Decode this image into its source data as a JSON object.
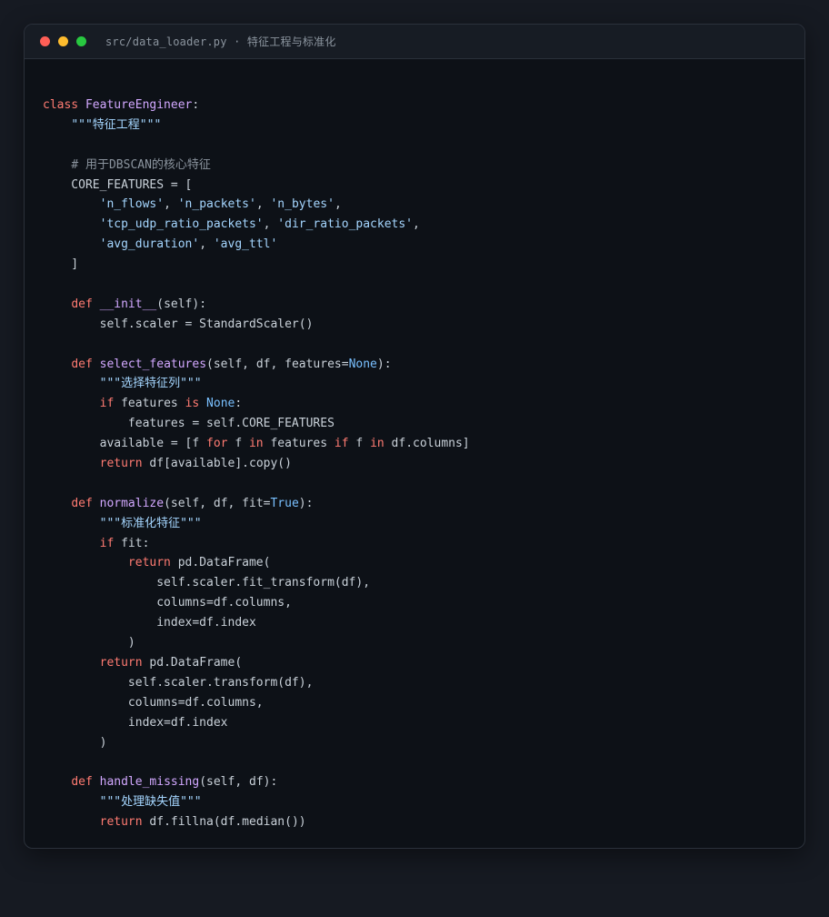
{
  "window": {
    "title": "src/data_loader.py · 特征工程与标准化",
    "controls": {
      "close_color": "#ff5f57",
      "minimize_color": "#febc2e",
      "maximize_color": "#28c840"
    }
  },
  "theme": {
    "background": "#0d1117",
    "keyword": "#ff7b72",
    "function": "#d2a8ff",
    "string": "#a5d6ff",
    "comment": "#8b949e",
    "constant": "#79c0ff",
    "text": "#c9d1d9"
  },
  "code_lines": [
    [
      {
        "t": "kw",
        "v": "class "
      },
      {
        "t": "cls",
        "v": "FeatureEngineer"
      },
      {
        "t": "txt",
        "v": ":"
      }
    ],
    [
      {
        "t": "txt",
        "v": "    "
      },
      {
        "t": "str",
        "v": "\"\"\"特征工程\"\"\""
      }
    ],
    [],
    [
      {
        "t": "txt",
        "v": "    "
      },
      {
        "t": "cmt",
        "v": "# 用于DBSCAN的核心特征"
      }
    ],
    [
      {
        "t": "txt",
        "v": "    CORE_FEATURES = ["
      }
    ],
    [
      {
        "t": "txt",
        "v": "        "
      },
      {
        "t": "str",
        "v": "'n_flows'"
      },
      {
        "t": "txt",
        "v": ", "
      },
      {
        "t": "str",
        "v": "'n_packets'"
      },
      {
        "t": "txt",
        "v": ", "
      },
      {
        "t": "str",
        "v": "'n_bytes'"
      },
      {
        "t": "txt",
        "v": ","
      }
    ],
    [
      {
        "t": "txt",
        "v": "        "
      },
      {
        "t": "str",
        "v": "'tcp_udp_ratio_packets'"
      },
      {
        "t": "txt",
        "v": ", "
      },
      {
        "t": "str",
        "v": "'dir_ratio_packets'"
      },
      {
        "t": "txt",
        "v": ","
      }
    ],
    [
      {
        "t": "txt",
        "v": "        "
      },
      {
        "t": "str",
        "v": "'avg_duration'"
      },
      {
        "t": "txt",
        "v": ", "
      },
      {
        "t": "str",
        "v": "'avg_ttl'"
      }
    ],
    [
      {
        "t": "txt",
        "v": "    ]"
      }
    ],
    [],
    [
      {
        "t": "txt",
        "v": "    "
      },
      {
        "t": "kw",
        "v": "def "
      },
      {
        "t": "fn",
        "v": "__init__"
      },
      {
        "t": "txt",
        "v": "(self):"
      }
    ],
    [
      {
        "t": "txt",
        "v": "        self.scaler = StandardScaler()"
      }
    ],
    [],
    [
      {
        "t": "txt",
        "v": "    "
      },
      {
        "t": "kw",
        "v": "def "
      },
      {
        "t": "fn",
        "v": "select_features"
      },
      {
        "t": "txt",
        "v": "(self, df, features="
      },
      {
        "t": "const",
        "v": "None"
      },
      {
        "t": "txt",
        "v": "):"
      }
    ],
    [
      {
        "t": "txt",
        "v": "        "
      },
      {
        "t": "str",
        "v": "\"\"\"选择特征列\"\"\""
      }
    ],
    [
      {
        "t": "txt",
        "v": "        "
      },
      {
        "t": "kw",
        "v": "if"
      },
      {
        "t": "txt",
        "v": " features "
      },
      {
        "t": "kw",
        "v": "is"
      },
      {
        "t": "txt",
        "v": " "
      },
      {
        "t": "const",
        "v": "None"
      },
      {
        "t": "txt",
        "v": ":"
      }
    ],
    [
      {
        "t": "txt",
        "v": "            features = self.CORE_FEATURES"
      }
    ],
    [
      {
        "t": "txt",
        "v": "        available = [f "
      },
      {
        "t": "kw",
        "v": "for"
      },
      {
        "t": "txt",
        "v": " f "
      },
      {
        "t": "kw",
        "v": "in"
      },
      {
        "t": "txt",
        "v": " features "
      },
      {
        "t": "kw",
        "v": "if"
      },
      {
        "t": "txt",
        "v": " f "
      },
      {
        "t": "kw",
        "v": "in"
      },
      {
        "t": "txt",
        "v": " df.columns]"
      }
    ],
    [
      {
        "t": "txt",
        "v": "        "
      },
      {
        "t": "kw",
        "v": "return"
      },
      {
        "t": "txt",
        "v": " df[available].copy()"
      }
    ],
    [],
    [
      {
        "t": "txt",
        "v": "    "
      },
      {
        "t": "kw",
        "v": "def "
      },
      {
        "t": "fn",
        "v": "normalize"
      },
      {
        "t": "txt",
        "v": "(self, df, fit="
      },
      {
        "t": "const",
        "v": "True"
      },
      {
        "t": "txt",
        "v": "):"
      }
    ],
    [
      {
        "t": "txt",
        "v": "        "
      },
      {
        "t": "str",
        "v": "\"\"\"标准化特征\"\"\""
      }
    ],
    [
      {
        "t": "txt",
        "v": "        "
      },
      {
        "t": "kw",
        "v": "if"
      },
      {
        "t": "txt",
        "v": " fit:"
      }
    ],
    [
      {
        "t": "txt",
        "v": "            "
      },
      {
        "t": "kw",
        "v": "return"
      },
      {
        "t": "txt",
        "v": " pd.DataFrame("
      }
    ],
    [
      {
        "t": "txt",
        "v": "                self.scaler.fit_transform(df),"
      }
    ],
    [
      {
        "t": "txt",
        "v": "                columns=df.columns,"
      }
    ],
    [
      {
        "t": "txt",
        "v": "                index=df.index"
      }
    ],
    [
      {
        "t": "txt",
        "v": "            )"
      }
    ],
    [
      {
        "t": "txt",
        "v": "        "
      },
      {
        "t": "kw",
        "v": "return"
      },
      {
        "t": "txt",
        "v": " pd.DataFrame("
      }
    ],
    [
      {
        "t": "txt",
        "v": "            self.scaler.transform(df),"
      }
    ],
    [
      {
        "t": "txt",
        "v": "            columns=df.columns,"
      }
    ],
    [
      {
        "t": "txt",
        "v": "            index=df.index"
      }
    ],
    [
      {
        "t": "txt",
        "v": "        )"
      }
    ],
    [],
    [
      {
        "t": "txt",
        "v": "    "
      },
      {
        "t": "kw",
        "v": "def "
      },
      {
        "t": "fn",
        "v": "handle_missing"
      },
      {
        "t": "txt",
        "v": "(self, df):"
      }
    ],
    [
      {
        "t": "txt",
        "v": "        "
      },
      {
        "t": "str",
        "v": "\"\"\"处理缺失值\"\"\""
      }
    ],
    [
      {
        "t": "txt",
        "v": "        "
      },
      {
        "t": "kw",
        "v": "return"
      },
      {
        "t": "txt",
        "v": " df.fillna(df.median())"
      }
    ]
  ]
}
